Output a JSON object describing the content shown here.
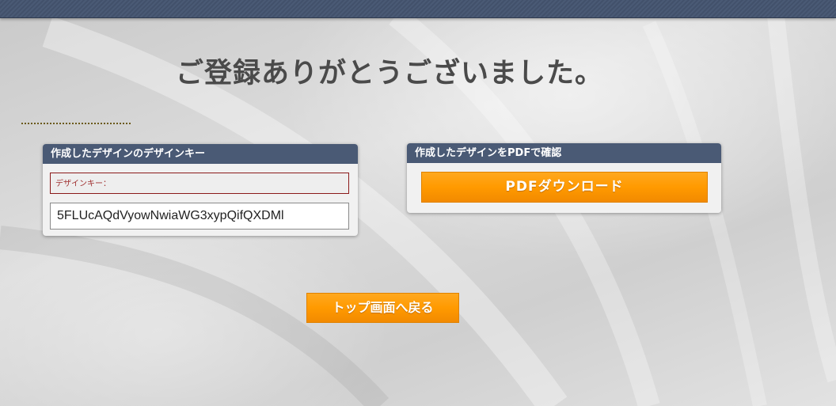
{
  "thanks": {
    "title": "ご登録ありがとうございました。"
  },
  "design_key_panel": {
    "header": "作成したデザインのデザインキー",
    "label": "デザインキー：",
    "value": "5FLUcAQdVyowNwiaWG3xypQifQXDMl"
  },
  "pdf_panel": {
    "header": "作成したデザインをPDFで確認",
    "button_label": "PDFダウンロード"
  },
  "nav": {
    "top_button_label": "トップ画面へ戻る"
  },
  "colors": {
    "header_bar": "#4a5a75",
    "accent_orange": "#ff9a00",
    "title_text": "#4a4a4a",
    "label_border": "#8b1a1a"
  }
}
